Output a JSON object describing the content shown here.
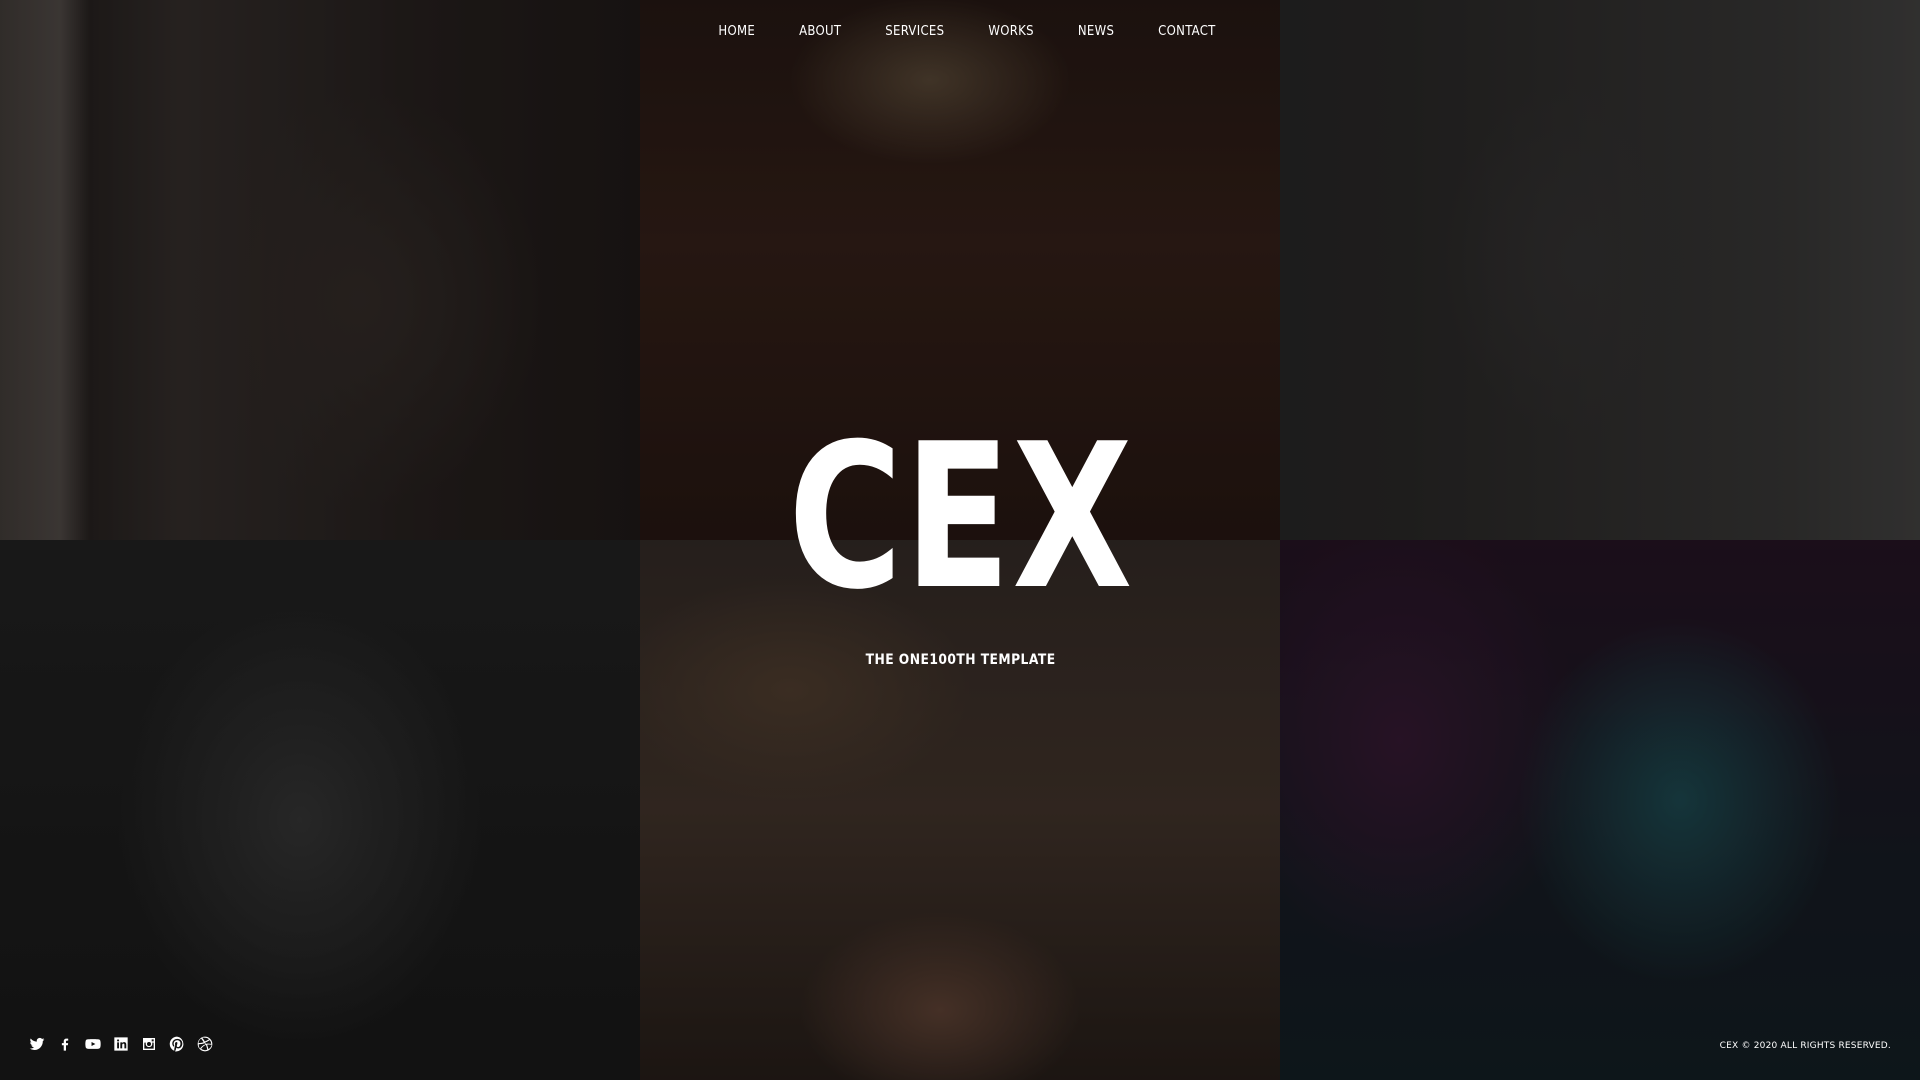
{
  "nav": {
    "items": [
      "HOME",
      "ABOUT",
      "SERVICES",
      "WORKS",
      "NEWS",
      "CONTACT"
    ]
  },
  "hero": {
    "title": "CEX",
    "subtitle": "THE ONE100TH TEMPLATE"
  },
  "social": {
    "icons": [
      "twitter-icon",
      "facebook-icon",
      "youtube-icon",
      "linkedin-icon",
      "instagram-icon",
      "pinterest-icon",
      "dribbble-icon"
    ]
  },
  "footer": {
    "copyright": "CEX © 2020 ALL RIGHTS RESERVED."
  },
  "colors": {
    "text": "#ffffff",
    "overlay": "#000000"
  }
}
